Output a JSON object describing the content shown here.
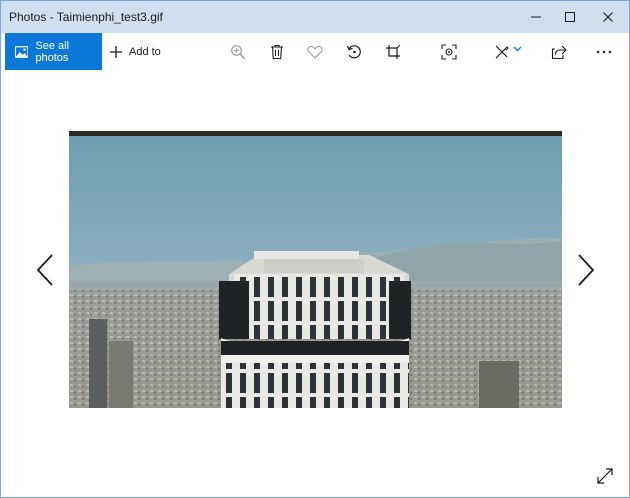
{
  "window": {
    "title": "Photos - Taimienphi_test3.gif",
    "minimize_icon": "minimize-icon",
    "maximize_icon": "maximize-icon",
    "close_icon": "close-icon"
  },
  "toolbar": {
    "see_all_label": "See all photos",
    "add_to_label": "Add to",
    "icons": [
      "zoom-icon",
      "delete-icon",
      "favorite-icon",
      "rotate-icon",
      "crop-icon",
      "enhance-icon",
      "edit-create-icon",
      "share-icon",
      "more-icon"
    ]
  },
  "viewer": {
    "previous_icon": "chevron-left-icon",
    "next_icon": "chevron-right-icon",
    "fullscreen_icon": "expand-icon"
  },
  "colors": {
    "accent": "#0b78d7",
    "titlebar": "#cfdff0"
  }
}
